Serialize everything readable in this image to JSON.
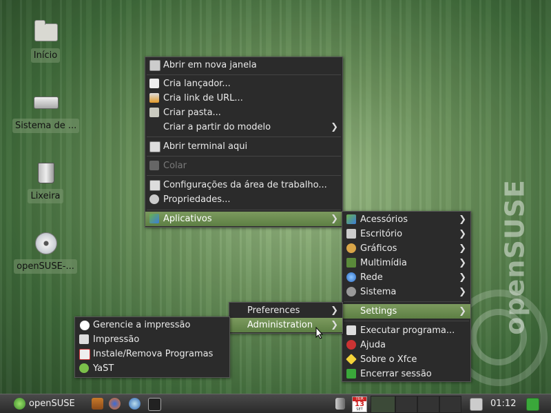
{
  "desktop": {
    "icons": [
      {
        "label": "Início"
      },
      {
        "label": "Sistema de ..."
      },
      {
        "label": "Lixeira"
      },
      {
        "label": "openSUSE-..."
      }
    ],
    "watermark": "openSUSE"
  },
  "context_menu": {
    "items": [
      {
        "label": "Abrir em nova janela"
      },
      {
        "label": "Cria lançador..."
      },
      {
        "label": "Cria link de URL..."
      },
      {
        "label": "Criar pasta..."
      },
      {
        "label": "Criar a partir do modelo"
      },
      {
        "label": "Abrir terminal aqui"
      },
      {
        "label": "Colar"
      },
      {
        "label": "Configurações da área de trabalho..."
      },
      {
        "label": "Propriedades..."
      },
      {
        "label": "Aplicativos"
      }
    ]
  },
  "apps_menu": {
    "items": [
      {
        "label": "Acessórios"
      },
      {
        "label": "Escritório"
      },
      {
        "label": "Gráficos"
      },
      {
        "label": "Multimídia"
      },
      {
        "label": "Rede"
      },
      {
        "label": "Sistema"
      },
      {
        "label": "Settings"
      },
      {
        "label": "Executar programa..."
      },
      {
        "label": "Ajuda"
      },
      {
        "label": "Sobre o Xfce"
      },
      {
        "label": "Encerrar sessão"
      }
    ]
  },
  "settings_menu": {
    "items": [
      {
        "label": "Preferences"
      },
      {
        "label": "Administration"
      }
    ]
  },
  "admin_menu": {
    "items": [
      {
        "label": "Gerencie a impressão"
      },
      {
        "label": "Impressão"
      },
      {
        "label": "Instale/Remova Programas"
      },
      {
        "label": "YaST"
      }
    ]
  },
  "taskbar": {
    "start_label": "openSUSE",
    "calendar_month": "TER",
    "calendar_day": "13",
    "calendar_wkday": "SET",
    "clock": "01:12"
  }
}
